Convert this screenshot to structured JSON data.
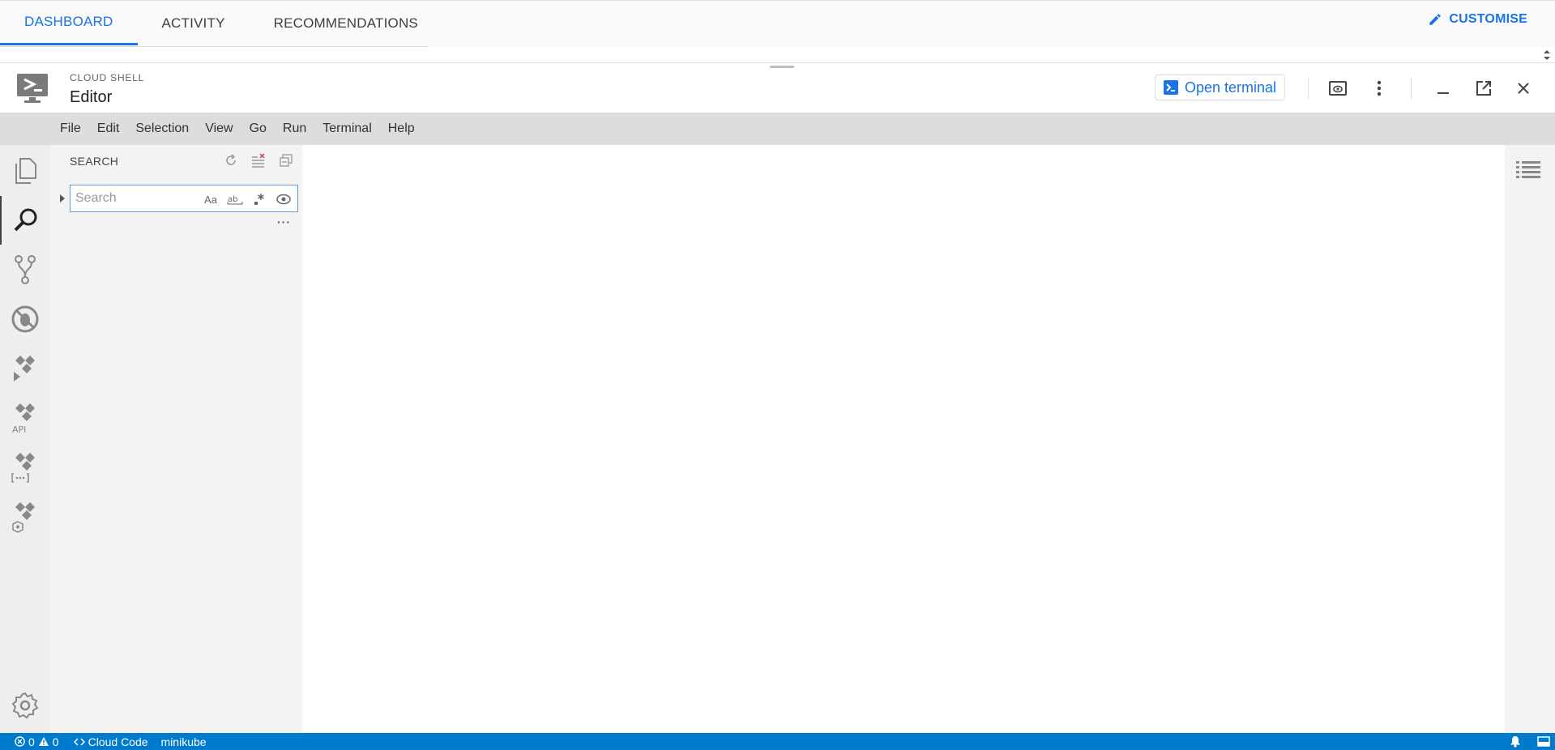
{
  "top_tabs": [
    {
      "label": "DASHBOARD",
      "active": true
    },
    {
      "label": "ACTIVITY",
      "active": false
    },
    {
      "label": "RECOMMENDATIONS",
      "active": false
    }
  ],
  "customise_label": "CUSTOMISE",
  "shell": {
    "subtitle": "CLOUD SHELL",
    "title": "Editor",
    "open_terminal_label": "Open terminal"
  },
  "menu": [
    "File",
    "Edit",
    "Selection",
    "View",
    "Go",
    "Run",
    "Terminal",
    "Help"
  ],
  "search_panel": {
    "title": "SEARCH",
    "placeholder": "Search",
    "value": "",
    "match_case": "Aa",
    "more": "···"
  },
  "status": {
    "errors": "0",
    "warnings": "0",
    "cloud_code": "Cloud Code",
    "cluster": "minikube"
  },
  "colors": {
    "accent": "#1a73e8",
    "status_bar": "#007acc"
  }
}
